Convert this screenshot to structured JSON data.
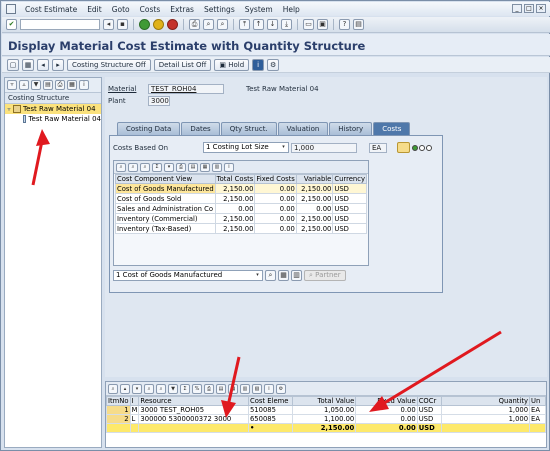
{
  "menu": {
    "items": [
      "Cost Estimate",
      "Edit",
      "Goto",
      "Costs",
      "Extras",
      "Settings",
      "System",
      "Help"
    ]
  },
  "title": "Display Material Cost Estimate with Quantity Structure",
  "app_toolbar": {
    "costing_structure_off": "Costing Structure Off",
    "detail_list_off": "Detail List Off",
    "hold": "Hold"
  },
  "tree": {
    "header": "Costing Structure",
    "items": [
      {
        "label": "Test Raw Material 04",
        "selected": true
      },
      {
        "label": "Test Raw Material 04",
        "selected": false
      }
    ]
  },
  "header_fields": {
    "material_label": "Material",
    "material_value": "TEST_ROH04",
    "material_desc": "Test Raw Material 04",
    "plant_label": "Plant",
    "plant_value": "3000"
  },
  "tabs": [
    "Costing Data",
    "Dates",
    "Qty Struct.",
    "Valuation",
    "History",
    "Costs"
  ],
  "active_tab": "Costs",
  "costs_based_on": {
    "label": "Costs Based On",
    "selection": "1 Costing Lot Size",
    "quantity": "1,000",
    "unit": "EA"
  },
  "cost_table": {
    "headers": [
      "Cost Component View",
      "Total Costs",
      "Fixed Costs",
      "Variable",
      "Currency"
    ],
    "rows": [
      [
        "Cost of Goods Manufactured",
        "2,150.00",
        "0.00",
        "2,150.00",
        "USD"
      ],
      [
        "Cost of Goods Sold",
        "2,150.00",
        "0.00",
        "2,150.00",
        "USD"
      ],
      [
        "Sales and Administration Co",
        "0.00",
        "0.00",
        "0.00",
        "USD"
      ],
      [
        "Inventory (Commercial)",
        "2,150.00",
        "0.00",
        "2,150.00",
        "USD"
      ],
      [
        "Inventory (Tax-Based)",
        "2,150.00",
        "0.00",
        "2,150.00",
        "USD"
      ]
    ]
  },
  "view_select": {
    "value": "1 Cost of Goods Manufactured",
    "partner_label": "Partner"
  },
  "item_table": {
    "headers": [
      "ItmNo",
      "I",
      "Resource",
      "Cost Eleme",
      "Total Value",
      "Fixed Value",
      "COCr",
      "Quantity",
      "Un"
    ],
    "rows": [
      [
        "1",
        "M",
        "3000 TEST_ROH05",
        "510085",
        "1,050.00",
        "0.00",
        "USD",
        "1,000",
        "EA"
      ],
      [
        "2",
        "L",
        "300000    5300000372 3000",
        "650085",
        "1,100.00",
        "0.00",
        "USD",
        "1,000",
        "EA"
      ]
    ],
    "total": {
      "total_value": "2,150.00",
      "fixed_value": "0.00",
      "currency": "USD"
    }
  },
  "colors": {
    "accent_tab": "#4f78aa",
    "selection": "#fbe27d",
    "arrow": "#e0191f"
  }
}
